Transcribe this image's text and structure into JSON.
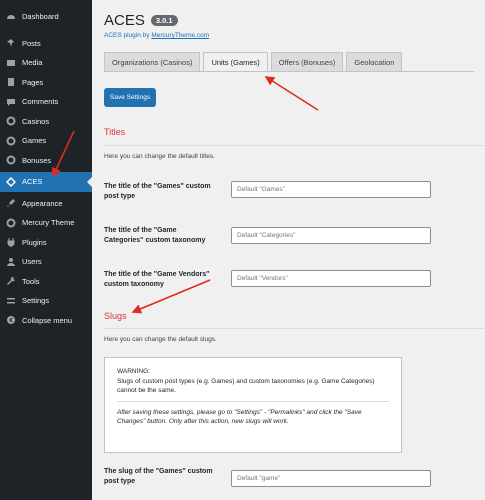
{
  "sidebar": {
    "items": [
      {
        "label": "Dashboard",
        "icon": "dashboard-icon"
      },
      {
        "label": "Posts",
        "icon": "pin-icon"
      },
      {
        "label": "Media",
        "icon": "media-icon"
      },
      {
        "label": "Pages",
        "icon": "page-icon"
      },
      {
        "label": "Comments",
        "icon": "comment-icon"
      },
      {
        "label": "Casinos",
        "icon": "gear-icon"
      },
      {
        "label": "Games",
        "icon": "gear-icon"
      },
      {
        "label": "Bonuses",
        "icon": "gear-icon"
      },
      {
        "label": "ACES",
        "icon": "aces-icon",
        "active": true
      },
      {
        "label": "Appearance",
        "icon": "brush-icon"
      },
      {
        "label": "Mercury Theme",
        "icon": "gear-icon"
      },
      {
        "label": "Plugins",
        "icon": "plug-icon"
      },
      {
        "label": "Users",
        "icon": "user-icon"
      },
      {
        "label": "Tools",
        "icon": "wrench-icon"
      },
      {
        "label": "Settings",
        "icon": "settings-icon"
      },
      {
        "label": "Collapse menu",
        "icon": "collapse-icon"
      }
    ]
  },
  "header": {
    "title": "ACES",
    "version": "3.0.1",
    "subtitle_prefix": "ACES plugin by ",
    "subtitle_link": "MercuryTheme.com"
  },
  "tabs": [
    {
      "label": "Organizations (Casinos)"
    },
    {
      "label": "Units (Games)",
      "active": true
    },
    {
      "label": "Offers (Bonuses)"
    },
    {
      "label": "Geolocation"
    }
  ],
  "save_button": "Save Settings",
  "titles_section": {
    "heading": "Titles",
    "description": "Here you can change the default titles."
  },
  "fields": [
    {
      "label": "The title of the \"Games\" custom post type",
      "value": "Default \"Games\""
    },
    {
      "label": "The title of the \"Game Categories\" custom taxonomy",
      "value": "Default \"Categories\""
    },
    {
      "label": "The title of the \"Game Vendors\" custom taxonomy",
      "value": "Default \"Vendors\""
    }
  ],
  "slugs_section": {
    "heading": "Slugs",
    "description": "Here you can change the default slugs."
  },
  "warning": {
    "title": "WARNING:",
    "text": "Slugs of custom post types (e.g. Games) and custom taxonomies (e.g. Game Categories) cannot be the same.",
    "note": "After saving these settings, please go to \"Settings\" - \"Permalinks\" and click the \"Save Changes\" button. Only after this action, new slugs will work."
  },
  "slug_field": {
    "label": "The slug of the \"Games\" custom post type",
    "value": "Default \"game\""
  },
  "colors": {
    "accent": "#2271b1",
    "sidebar_bg": "#1d2327",
    "heading_red": "#d63638",
    "annotation_arrow": "#e02b20"
  }
}
